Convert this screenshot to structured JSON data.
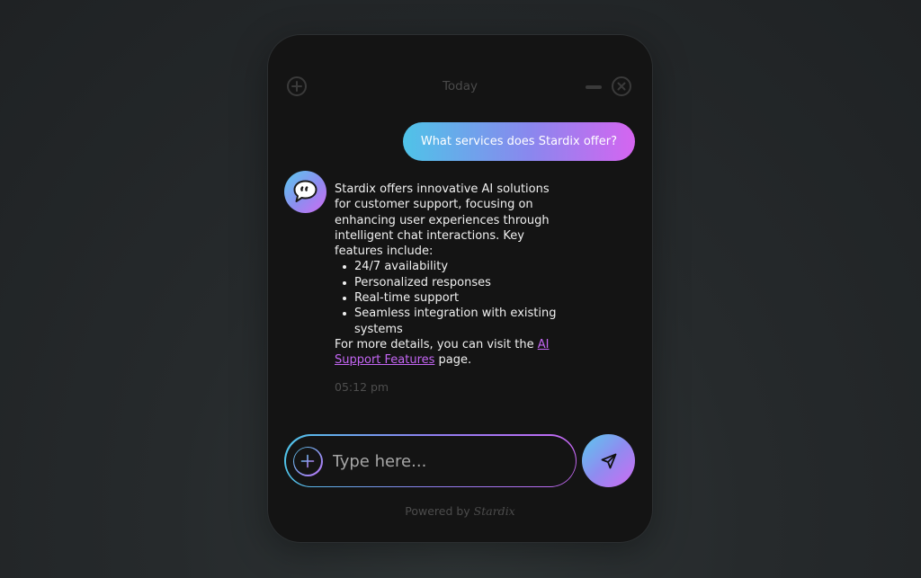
{
  "header": {
    "title": "Today",
    "add_icon": "plus-circle-icon",
    "minimize_icon": "minus-icon",
    "close_icon": "close-circle-icon"
  },
  "messages": {
    "user": {
      "text": "What services does Stardix offer?"
    },
    "bot": {
      "avatar_icon": "speech-bubble-icon",
      "intro": "Stardix offers innovative AI solutions for customer support, focusing on enhancing user experiences through intelligent chat interactions. Key features include:",
      "features": [
        "24/7 availability",
        "Personalized responses",
        "Real-time support",
        "Seamless integration with existing systems"
      ],
      "outro_prefix": "For more details, you can visit the ",
      "link_text": "AI Support Features",
      "outro_suffix": " page.",
      "timestamp": "05:12 pm"
    }
  },
  "composer": {
    "placeholder": "Type here...",
    "add_icon": "plus-circle-icon",
    "send_icon": "send-icon"
  },
  "footer": {
    "prefix": "Powered by ",
    "brand": "Stardix"
  },
  "colors": {
    "gradient_start": "#4fc3e8",
    "gradient_mid": "#8f8cf0",
    "gradient_end": "#cf6bf2",
    "panel_bg": "#141414",
    "link": "#c466f4"
  }
}
